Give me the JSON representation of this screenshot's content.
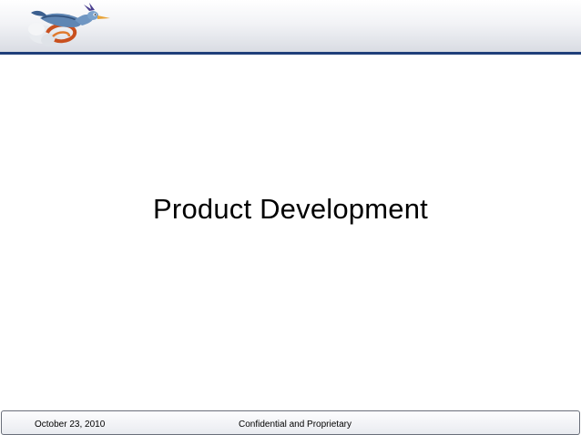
{
  "slide": {
    "title": "Product Development",
    "footer": {
      "date": "October 23, 2010",
      "confidential": "Confidential and Proprietary"
    }
  },
  "logo": {
    "icon": "roadrunner-logo-icon"
  },
  "colors": {
    "header_rule": "#1f3f7a",
    "background": "#ffffff",
    "footer_border": "#6a6f7a"
  }
}
